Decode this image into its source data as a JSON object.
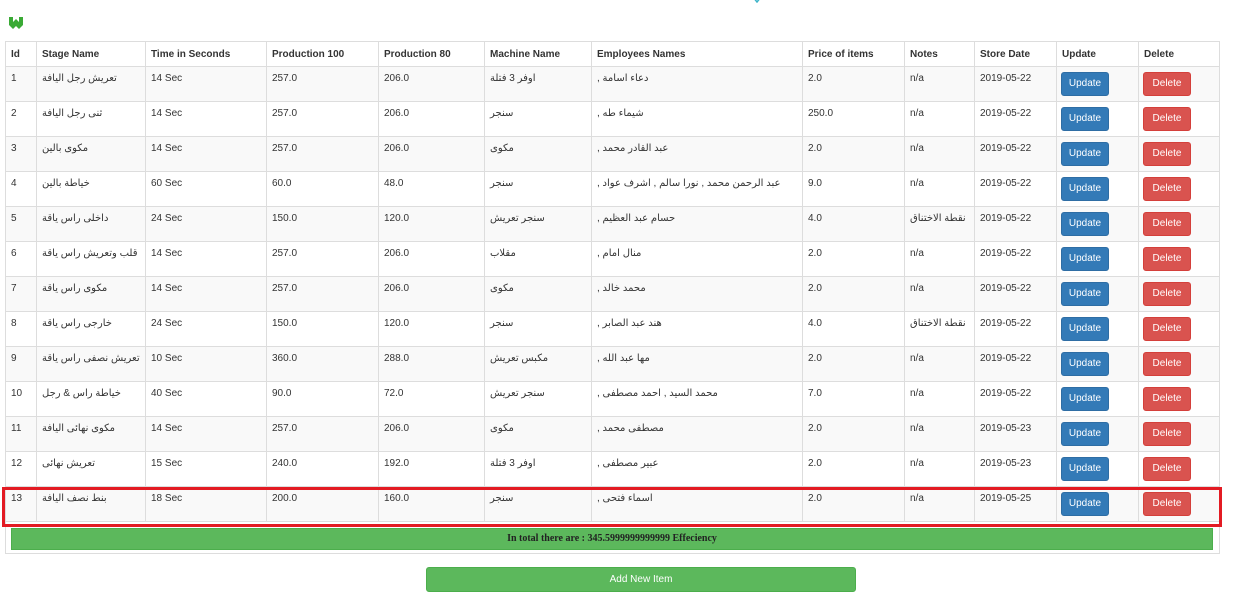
{
  "headers": {
    "id": "Id",
    "stage": "Stage Name",
    "time": "Time in Seconds",
    "p100": "Production 100",
    "p80": "Production 80",
    "machine": "Machine Name",
    "employees": "Employees Names",
    "price": "Price of items",
    "notes": "Notes",
    "date": "Store Date",
    "update": "Update",
    "delete": "Delete"
  },
  "buttons": {
    "update": "Update",
    "delete": "Delete",
    "add": "Add New Item"
  },
  "summary": "In total there are : 345.5999999999999 Effeciency",
  "rows": [
    {
      "id": "1",
      "stage": "تعريش رجل اليافة",
      "time": "14 Sec",
      "p100": "257.0",
      "p80": "206.0",
      "machine": "اوفر 3 فتلة",
      "employees": "دعاء اسامة ,",
      "price": "2.0",
      "notes": "n/a",
      "date": "2019-05-22"
    },
    {
      "id": "2",
      "stage": "ثنى رجل اليافة",
      "time": "14 Sec",
      "p100": "257.0",
      "p80": "206.0",
      "machine": "سنجر",
      "employees": "شيماء طه ,",
      "price": "250.0",
      "notes": "n/a",
      "date": "2019-05-22"
    },
    {
      "id": "3",
      "stage": "مكوى بالين",
      "time": "14 Sec",
      "p100": "257.0",
      "p80": "206.0",
      "machine": "مكوى",
      "employees": "عبد القادر محمد ,",
      "price": "2.0",
      "notes": "n/a",
      "date": "2019-05-22"
    },
    {
      "id": "4",
      "stage": "خياطة بالين",
      "time": "60 Sec",
      "p100": "60.0",
      "p80": "48.0",
      "machine": "سنجر",
      "employees": "عبد الرحمن محمد , نورا سالم , اشرف عواد ,",
      "price": "9.0",
      "notes": "n/a",
      "date": "2019-05-22"
    },
    {
      "id": "5",
      "stage": "داخلى راس ياقة",
      "time": "24 Sec",
      "p100": "150.0",
      "p80": "120.0",
      "machine": "سنجر تعريش",
      "employees": "حسام عبد العظيم ,",
      "price": "4.0",
      "notes": "نقطة الاختناق",
      "date": "2019-05-22"
    },
    {
      "id": "6",
      "stage": "قلب وتعريش راس ياقة",
      "time": "14 Sec",
      "p100": "257.0",
      "p80": "206.0",
      "machine": "مقلاب",
      "employees": "منال امام ,",
      "price": "2.0",
      "notes": "n/a",
      "date": "2019-05-22"
    },
    {
      "id": "7",
      "stage": "مكوى راس ياقة",
      "time": "14 Sec",
      "p100": "257.0",
      "p80": "206.0",
      "machine": "مكوى",
      "employees": "محمد خالد ,",
      "price": "2.0",
      "notes": "n/a",
      "date": "2019-05-22"
    },
    {
      "id": "8",
      "stage": "خارجى راس ياقة",
      "time": "24 Sec",
      "p100": "150.0",
      "p80": "120.0",
      "machine": "سنجر",
      "employees": "هند عبد الصابر ,",
      "price": "4.0",
      "notes": "نقطة الاختناق",
      "date": "2019-05-22"
    },
    {
      "id": "9",
      "stage": "تعريش نصفى راس ياقة",
      "time": "10 Sec",
      "p100": "360.0",
      "p80": "288.0",
      "machine": "مكبس تعريش",
      "employees": "مها عبد الله ,",
      "price": "2.0",
      "notes": "n/a",
      "date": "2019-05-22"
    },
    {
      "id": "10",
      "stage": "خياطة راس & رجل",
      "time": "40 Sec",
      "p100": "90.0",
      "p80": "72.0",
      "machine": "سنجر تعريش",
      "employees": "محمد السيد , احمد مصطفى ,",
      "price": "7.0",
      "notes": "n/a",
      "date": "2019-05-22"
    },
    {
      "id": "11",
      "stage": "مكوى نهائى اليافة",
      "time": "14 Sec",
      "p100": "257.0",
      "p80": "206.0",
      "machine": "مكوى",
      "employees": "مصطفى محمد ,",
      "price": "2.0",
      "notes": "n/a",
      "date": "2019-05-23"
    },
    {
      "id": "12",
      "stage": "تعريش نهائى",
      "time": "15 Sec",
      "p100": "240.0",
      "p80": "192.0",
      "machine": "اوفر 3 فتلة",
      "employees": "عبير مصطفى ,",
      "price": "2.0",
      "notes": "n/a",
      "date": "2019-05-23"
    },
    {
      "id": "13",
      "stage": "بنط نصف اليافة",
      "time": "18 Sec",
      "p100": "200.0",
      "p80": "160.0",
      "machine": "سنجر",
      "employees": "اسماء فتحى ,",
      "price": "2.0",
      "notes": "n/a",
      "date": "2019-05-25"
    }
  ],
  "colors": {
    "primary": "#337ab7",
    "danger": "#d9534f",
    "success": "#5cb85c",
    "highlight": "#e31b23"
  }
}
